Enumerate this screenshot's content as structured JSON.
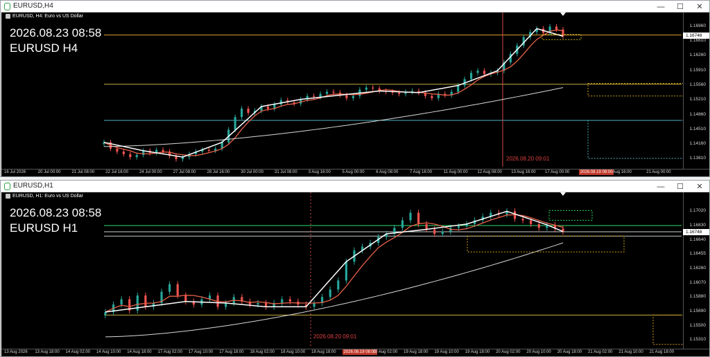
{
  "windows": [
    {
      "title": "EURUSD,H4",
      "header": "EURUSD, H4:  Euro vs US Dollar",
      "big_date": "2026.08.23 08:58",
      "big_symbol": "EURUSD H4",
      "vline_time": "2026.08.20 09:01",
      "selected_time": "2026.08.19 08:00",
      "current_price": "1.16748",
      "y_labels": [
        "1.16960",
        "1.16610",
        "1.16260",
        "1.15910",
        "1.15560",
        "1.15210",
        "1.14860",
        "1.14510",
        "1.14160",
        "1.13810"
      ],
      "x_labels": [
        "16 Jul 2026",
        "20 Jul 00:00",
        "21 Jul 08:00",
        "22 Jul 16:00",
        "24 Jul 00:00",
        "27 Jul 08:00",
        "28 Jul 16:00",
        "30 Jul 00:00",
        "31 Jul 08:00",
        "3 Aug 16:00",
        "5 Aug 00:00",
        "6 Aug 08:00",
        "7 Aug 16:00",
        "11 Aug 00:00",
        "12 Aug 08:00",
        "13 Aug 16:00",
        "17 Aug 00:00",
        "",
        "Aug 16:00",
        "21 Aug 00:00"
      ],
      "chart_data": {
        "type": "candlestick",
        "timeframe": "H4",
        "y_range": [
          1.1362,
          1.1712
        ],
        "horizontal_levels": [
          1.16748,
          1.1558,
          1.1472
        ],
        "close_series": [
          1.142,
          1.1405,
          1.1398,
          1.1392,
          1.1385,
          1.139,
          1.14,
          1.1395,
          1.1402,
          1.1398,
          1.1388,
          1.138,
          1.1385,
          1.1392,
          1.1398,
          1.1402,
          1.14,
          1.1405,
          1.142,
          1.145,
          1.148,
          1.15,
          1.149,
          1.1495,
          1.1505,
          1.15,
          1.151,
          1.152,
          1.1515,
          1.1512,
          1.1522,
          1.153,
          1.1528,
          1.1535,
          1.154,
          1.1538,
          1.1532,
          1.1525,
          1.153,
          1.1545,
          1.155,
          1.1548,
          1.1542,
          1.154,
          1.1538,
          1.1535,
          1.154,
          1.1542,
          1.1538,
          1.153,
          1.1525,
          1.1535,
          1.1532,
          1.154,
          1.1555,
          1.157,
          1.1585,
          1.159,
          1.1582,
          1.1585,
          1.159,
          1.161,
          1.163,
          1.165,
          1.167,
          1.1682,
          1.169,
          1.168,
          1.1695,
          1.1688,
          1.1672
        ]
      }
    },
    {
      "title": "EURUSD,H1",
      "header": "EURUSD, H1:  Euro vs US Dollar",
      "big_date": "2026.08.23 08:58",
      "big_symbol": "EURUSD H1",
      "vline_time": "2026.08.20 09:01",
      "selected_time": "2026.08.19 08:00",
      "current_price": "1.16748",
      "y_labels": [
        "1.17020",
        "1.16830",
        "1.16640",
        "1.16455",
        "1.16260",
        "1.16070",
        "1.15880",
        "1.15690",
        "1.15500",
        "1.15310"
      ],
      "x_labels": [
        "13 Aug 2026",
        "13 Aug 18:00",
        "14 Aug 02:00",
        "14 Aug 10:00",
        "14 Aug 18:00",
        "17 Aug 02:00",
        "17 Aug 10:00",
        "17 Aug 18:00",
        "18 Aug 02:00",
        "18 Aug 10:00",
        "18 Aug 18:00",
        "",
        "19 Aug 02:00",
        "19 Aug 18:00",
        "19 Aug 10:00",
        "19 Aug 18:00",
        "20 Aug 02:00",
        "20 Aug 10:00",
        "20 Aug 18:00",
        "21 Aug 02:00",
        "21 Aug 10:00",
        "21 Aug 18:00"
      ],
      "chart_data": {
        "type": "candlestick",
        "timeframe": "H1",
        "y_range": [
          1.1522,
          1.1718
        ],
        "horizontal_levels": [
          1.1683,
          1.16748,
          1.1669,
          1.1564
        ],
        "close_series": [
          1.1568,
          1.1578,
          1.1585,
          1.157,
          1.159,
          1.1575,
          1.158,
          1.1595,
          1.1605,
          1.159,
          1.1582,
          1.1578,
          1.1585,
          1.159,
          1.1575,
          1.158,
          1.1588,
          1.1582,
          1.1578,
          1.158,
          1.1575,
          1.158,
          1.1585,
          1.1582,
          1.1578,
          1.1575,
          1.158,
          1.1588,
          1.1598,
          1.161,
          1.1635,
          1.165,
          1.1655,
          1.166,
          1.1668,
          1.1672,
          1.168,
          1.169,
          1.17,
          1.1685,
          1.1678,
          1.1672,
          1.1675,
          1.168,
          1.1682,
          1.1685,
          1.169,
          1.1695,
          1.17,
          1.1698,
          1.1702,
          1.1692,
          1.169,
          1.1685,
          1.168,
          1.1684,
          1.1679,
          1.1675
        ]
      }
    }
  ],
  "window_buttons": {
    "minimize": "—",
    "maximize": "☐",
    "close": "✕"
  },
  "colors": {
    "background": "#000000",
    "bull": "#26a69a",
    "bear": "#ef5350",
    "ma_fast": "#e8624a",
    "ma_slow": "#d9d9d9",
    "zigzag": "#ffffff",
    "level_orange": "#d4a017",
    "level_teal": "#4fb3bf",
    "level_green": "#2ee06b",
    "vline": "#d84a4a"
  }
}
